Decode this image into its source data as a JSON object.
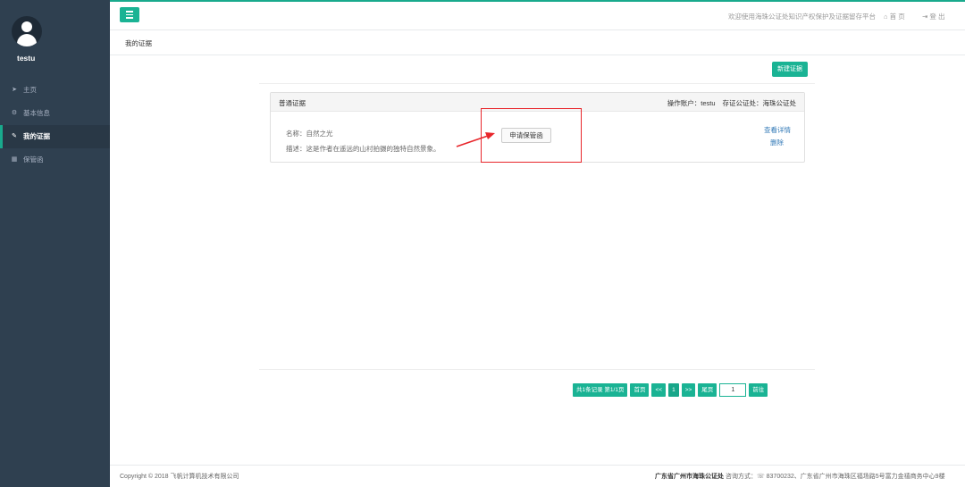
{
  "sidebar": {
    "username": "testu",
    "items": [
      {
        "label": "主页",
        "icon": "➤"
      },
      {
        "label": "基本信息",
        "icon": "⚙"
      },
      {
        "label": "我的证据",
        "icon": "✎"
      },
      {
        "label": "保管函",
        "icon": "▦"
      }
    ]
  },
  "header": {
    "welcome": "欢迎使用海珠公证处知识产权保护及证据留存平台",
    "home": "⌂ 首 页",
    "logout": "⇥ 登 出"
  },
  "breadcrumb": {
    "title": "我的证据"
  },
  "toolbar": {
    "new_label": "新建证据"
  },
  "card": {
    "type": "普通证据",
    "operator_label": "操作账户：",
    "operator": "testu",
    "office_label": "存证公证处：",
    "office": "海珠公证处",
    "name": "名称：自然之光",
    "desc": "描述：这是作者在遥远的山村拍摄的独特自然景象。",
    "apply_label": "申请保管函",
    "view_label": "查看详情",
    "delete_label": "删除"
  },
  "pager": {
    "summary": "共1条记录 第1/1页",
    "first": "首页",
    "prev": "<<",
    "current": "1",
    "next": ">>",
    "last": "尾页",
    "input_value": "1",
    "go": "前往"
  },
  "footer": {
    "copyright": "Copyright © 2018 飞帆计算机技术有限公司",
    "org": "广东省广州市海珠公证处",
    "contact": " 咨询方式：☏ 83700232、广东省广州市海珠区福场路5号富力金禧商务中心9楼"
  },
  "colors": {
    "accent": "#1ab394",
    "sidebar": "#2f4050",
    "highlight": "#e8262b"
  }
}
